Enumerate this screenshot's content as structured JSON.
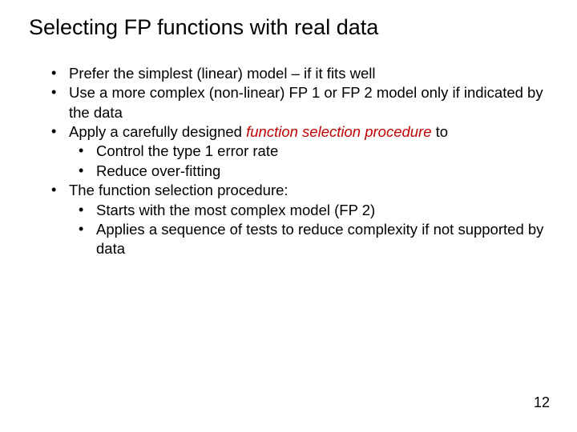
{
  "title": "Selecting FP functions with real data",
  "bullets": {
    "b1": "Prefer the simplest (linear) model – if it fits well",
    "b2": "Use a more complex (non-linear) FP 1 or FP 2 model only if indicated by the data",
    "b3_pre": "Apply a carefully designed ",
    "b3_emph": "function selection procedure",
    "b3_post": " to",
    "b3_sub1": "Control the type 1 error rate",
    "b3_sub2": "Reduce over-fitting",
    "b4": "The function selection procedure:",
    "b4_sub1": "Starts with the most complex model (FP 2)",
    "b4_sub2": "Applies a sequence of tests to reduce complexity if not supported by data"
  },
  "page_number": "12"
}
